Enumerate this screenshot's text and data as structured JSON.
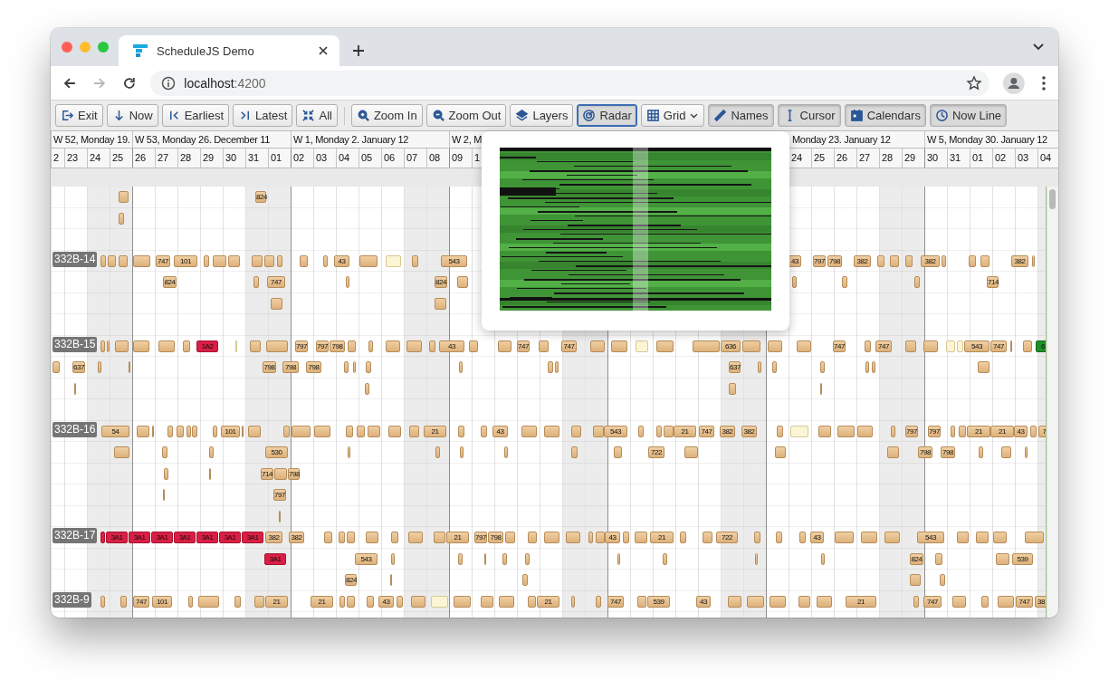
{
  "browser": {
    "tab": {
      "title": "ScheduleJS Demo"
    },
    "nav": [
      {
        "kind": "back",
        "disabled": false
      },
      {
        "kind": "forward",
        "disabled": true
      },
      {
        "kind": "reload",
        "disabled": false
      }
    ],
    "url": {
      "host": "localhost",
      "port": ":4200"
    }
  },
  "toolbar": {
    "groups": [
      [
        {
          "label": "Exit",
          "pressed": false,
          "focused": false,
          "dropdown": false
        },
        {
          "label": "Now",
          "pressed": false,
          "focused": false,
          "dropdown": false
        },
        {
          "label": "Earliest",
          "pressed": false,
          "focused": false,
          "dropdown": false
        },
        {
          "label": "Latest",
          "pressed": false,
          "focused": false,
          "dropdown": false
        },
        {
          "label": "All",
          "pressed": false,
          "focused": false,
          "dropdown": false
        }
      ],
      [
        {
          "label": "Zoom In",
          "pressed": false,
          "focused": false,
          "dropdown": false
        },
        {
          "label": "Zoom Out",
          "pressed": false,
          "focused": false,
          "dropdown": false
        },
        {
          "label": "Layers",
          "pressed": false,
          "focused": false,
          "dropdown": false
        },
        {
          "label": "Radar",
          "pressed": true,
          "focused": true,
          "dropdown": false
        },
        {
          "label": "Grid",
          "pressed": false,
          "focused": false,
          "dropdown": true
        },
        {
          "label": "Names",
          "pressed": true,
          "focused": false,
          "dropdown": false
        },
        {
          "label": "Cursor",
          "pressed": true,
          "focused": false,
          "dropdown": false
        },
        {
          "label": "Calendars",
          "pressed": true,
          "focused": false,
          "dropdown": false
        },
        {
          "label": "Now Line",
          "pressed": true,
          "focused": false,
          "dropdown": false
        }
      ]
    ]
  },
  "timeline": {
    "weeks": [
      {
        "label": "W 52, Monday 19."
      },
      {
        "label": "W 53, Monday 26. December 11"
      },
      {
        "label": "W 1, Monday 2. January 12"
      },
      {
        "label": "W 2, M"
      },
      {
        "label": "Monday 23. January 12"
      },
      {
        "label": "W 5, Monday 30. January 12"
      }
    ],
    "days": [
      {
        "label": "2"
      },
      {
        "label": "23"
      },
      {
        "label": "24"
      },
      {
        "label": "25"
      },
      {
        "label": "26"
      },
      {
        "label": "27"
      },
      {
        "label": "28"
      },
      {
        "label": "29"
      },
      {
        "label": "30"
      },
      {
        "label": "31"
      },
      {
        "label": "01"
      },
      {
        "label": "02"
      },
      {
        "label": "03"
      },
      {
        "label": "04"
      },
      {
        "label": "05"
      },
      {
        "label": "06"
      },
      {
        "label": "07"
      },
      {
        "label": "08"
      },
      {
        "label": "09"
      },
      {
        "label": "1"
      },
      {
        "label": "24"
      },
      {
        "label": "25"
      },
      {
        "label": "26"
      },
      {
        "label": "27"
      },
      {
        "label": "28"
      },
      {
        "label": "29"
      },
      {
        "label": "30"
      },
      {
        "label": "31"
      },
      {
        "label": "01"
      },
      {
        "label": "02"
      },
      {
        "label": "03"
      },
      {
        "label": "04"
      }
    ]
  },
  "radar": {
    "visible": true
  },
  "lanes": [
    {
      "rows": [
        {
          "bars": [
            {
              "kind": "normal"
            },
            {
              "kind": "normal",
              "label": "824"
            }
          ]
        },
        {
          "bars": [
            {
              "kind": "normal"
            }
          ]
        },
        {}
      ]
    },
    {
      "name": "332B-14",
      "rows": [
        {
          "bars": [
            {
              "kind": "normal"
            },
            {
              "kind": "normal"
            },
            {
              "kind": "normal"
            },
            {
              "kind": "normal"
            },
            {
              "kind": "normal",
              "label": "747"
            },
            {
              "kind": "normal",
              "label": "101"
            },
            {
              "kind": "normal"
            },
            {
              "kind": "normal"
            },
            {
              "kind": "normal"
            },
            {
              "kind": "normal"
            },
            {
              "kind": "normal"
            },
            {
              "kind": "normal"
            },
            {
              "kind": "normal"
            },
            {
              "kind": "normal"
            },
            {
              "kind": "normal",
              "label": "43"
            },
            {
              "kind": "normal"
            },
            {
              "kind": "tentative"
            },
            {
              "kind": "normal"
            },
            {
              "kind": "normal",
              "label": "543"
            },
            {
              "kind": "normal",
              "label": "43"
            },
            {
              "kind": "normal",
              "label": "797"
            },
            {
              "kind": "normal",
              "label": "798"
            },
            {
              "kind": "normal",
              "label": "382"
            },
            {
              "kind": "normal"
            },
            {
              "kind": "normal"
            },
            {
              "kind": "normal"
            },
            {
              "kind": "normal",
              "label": "382"
            },
            {
              "kind": "normal"
            },
            {
              "kind": "normal"
            },
            {
              "kind": "normal"
            },
            {
              "kind": "normal",
              "label": "382"
            },
            {
              "kind": "normal"
            }
          ]
        },
        {
          "bars": [
            {
              "kind": "normal",
              "label": "824"
            },
            {
              "kind": "normal"
            },
            {
              "kind": "normal",
              "label": "747"
            },
            {
              "kind": "normal"
            },
            {
              "kind": "normal",
              "label": "824"
            },
            {
              "kind": "normal"
            },
            {
              "kind": "normal"
            },
            {
              "kind": "normal"
            },
            {
              "kind": "normal"
            },
            {
              "kind": "normal",
              "label": "714"
            }
          ]
        },
        {
          "bars": [
            {
              "kind": "normal"
            },
            {
              "kind": "normal"
            }
          ]
        },
        {}
      ]
    },
    {
      "name": "332B-15",
      "rows": [
        {
          "bars": [
            {
              "kind": "normal"
            },
            {
              "kind": "normal"
            },
            {
              "kind": "normal"
            },
            {
              "kind": "normal"
            },
            {
              "kind": "normal"
            },
            {
              "kind": "normal"
            },
            {
              "kind": "critical",
              "label": "1A2"
            },
            {
              "kind": "tentative"
            },
            {
              "kind": "normal"
            },
            {
              "kind": "normal"
            },
            {
              "kind": "normal",
              "label": "797"
            },
            {
              "kind": "normal",
              "label": "797"
            },
            {
              "kind": "normal",
              "label": "798"
            },
            {
              "kind": "normal"
            },
            {
              "kind": "normal"
            },
            {
              "kind": "normal"
            },
            {
              "kind": "normal"
            },
            {
              "kind": "normal"
            },
            {
              "kind": "normal",
              "label": "43"
            },
            {
              "kind": "normal"
            },
            {
              "kind": "normal"
            },
            {
              "kind": "normal",
              "label": "747"
            },
            {
              "kind": "normal"
            },
            {
              "kind": "normal",
              "label": "747"
            },
            {
              "kind": "normal"
            },
            {
              "kind": "normal"
            },
            {
              "kind": "tentative"
            },
            {
              "kind": "normal"
            },
            {
              "kind": "normal"
            },
            {
              "kind": "normal",
              "label": "636"
            },
            {
              "kind": "normal"
            },
            {
              "kind": "normal"
            },
            {
              "kind": "normal"
            },
            {
              "kind": "normal",
              "label": "747"
            },
            {
              "kind": "normal"
            },
            {
              "kind": "normal",
              "label": "747"
            },
            {
              "kind": "normal"
            },
            {
              "kind": "normal"
            },
            {
              "kind": "tentative"
            },
            {
              "kind": "tentative"
            },
            {
              "kind": "normal",
              "label": "543"
            },
            {
              "kind": "normal",
              "label": "747"
            },
            {
              "kind": "normal"
            },
            {
              "kind": "normal"
            },
            {
              "kind": "done",
              "label": "6"
            }
          ]
        },
        {
          "bars": [
            {
              "kind": "normal"
            },
            {
              "kind": "normal",
              "label": "637"
            },
            {
              "kind": "normal"
            },
            {
              "kind": "normal"
            },
            {
              "kind": "normal",
              "label": "798"
            },
            {
              "kind": "normal",
              "label": "798"
            },
            {
              "kind": "normal",
              "label": "798"
            },
            {
              "kind": "normal"
            },
            {
              "kind": "normal"
            },
            {
              "kind": "normal"
            },
            {
              "kind": "normal"
            },
            {
              "kind": "normal"
            },
            {
              "kind": "normal"
            },
            {
              "kind": "normal",
              "label": "637"
            },
            {
              "kind": "normal"
            },
            {
              "kind": "normal"
            },
            {
              "kind": "normal"
            },
            {
              "kind": "normal"
            },
            {
              "kind": "normal"
            },
            {
              "kind": "normal"
            }
          ]
        },
        {
          "bars": [
            {
              "kind": "normal"
            },
            {
              "kind": "normal"
            },
            {
              "kind": "normal"
            },
            {
              "kind": "normal"
            }
          ]
        },
        {}
      ]
    },
    {
      "name": "332B-16",
      "rows": [
        {
          "bars": [
            {
              "kind": "normal",
              "label": "54"
            },
            {
              "kind": "normal"
            },
            {
              "kind": "normal"
            },
            {
              "kind": "normal"
            },
            {
              "kind": "normal"
            },
            {
              "kind": "normal"
            },
            {
              "kind": "normal"
            },
            {
              "kind": "normal"
            },
            {
              "kind": "normal",
              "label": "101"
            },
            {
              "kind": "normal"
            },
            {
              "kind": "normal"
            },
            {
              "kind": "normal"
            },
            {
              "kind": "normal"
            },
            {
              "kind": "normal"
            },
            {
              "kind": "normal"
            },
            {
              "kind": "normal"
            },
            {
              "kind": "normal"
            },
            {
              "kind": "normal"
            },
            {
              "kind": "normal"
            },
            {
              "kind": "normal",
              "label": "21"
            },
            {
              "kind": "normal"
            },
            {
              "kind": "normal"
            },
            {
              "kind": "normal",
              "label": "43"
            },
            {
              "kind": "normal"
            },
            {
              "kind": "normal"
            },
            {
              "kind": "normal"
            },
            {
              "kind": "normal"
            },
            {
              "kind": "normal",
              "label": "543"
            },
            {
              "kind": "normal"
            },
            {
              "kind": "normal"
            },
            {
              "kind": "normal"
            },
            {
              "kind": "normal",
              "label": "21"
            },
            {
              "kind": "normal",
              "label": "747"
            },
            {
              "kind": "normal",
              "label": "382"
            },
            {
              "kind": "normal",
              "label": "382"
            },
            {
              "kind": "normal"
            },
            {
              "kind": "tentative"
            },
            {
              "kind": "normal"
            },
            {
              "kind": "normal"
            },
            {
              "kind": "normal"
            },
            {
              "kind": "normal"
            },
            {
              "kind": "normal",
              "label": "797"
            },
            {
              "kind": "normal",
              "label": "797"
            },
            {
              "kind": "normal"
            },
            {
              "kind": "normal"
            },
            {
              "kind": "normal",
              "label": "21"
            },
            {
              "kind": "normal",
              "label": "21"
            },
            {
              "kind": "normal",
              "label": "43"
            },
            {
              "kind": "normal"
            },
            {
              "kind": "normal",
              "label": "7"
            }
          ]
        },
        {
          "bars": [
            {
              "kind": "normal"
            },
            {
              "kind": "normal"
            },
            {
              "kind": "normal"
            },
            {
              "kind": "normal",
              "label": "530"
            },
            {
              "kind": "normal"
            },
            {
              "kind": "normal"
            },
            {
              "kind": "normal"
            },
            {
              "kind": "normal"
            },
            {
              "kind": "normal"
            },
            {
              "kind": "normal"
            },
            {
              "kind": "normal",
              "label": "722"
            },
            {
              "kind": "normal"
            },
            {
              "kind": "normal"
            },
            {
              "kind": "normal"
            },
            {
              "kind": "normal",
              "label": "798"
            },
            {
              "kind": "normal",
              "label": "798"
            },
            {
              "kind": "normal"
            },
            {
              "kind": "normal"
            },
            {
              "kind": "normal"
            }
          ]
        },
        {
          "bars": [
            {
              "kind": "normal"
            },
            {
              "kind": "normal"
            },
            {
              "kind": "normal",
              "label": "714"
            },
            {
              "kind": "normal"
            },
            {
              "kind": "normal",
              "label": "798"
            }
          ]
        },
        {
          "bars": [
            {
              "kind": "normal"
            },
            {
              "kind": "normal",
              "label": "797"
            }
          ]
        },
        {
          "bars": [
            {
              "kind": "normal"
            }
          ]
        }
      ]
    },
    {
      "name": "332B-17",
      "rows": [
        {
          "bars": [
            {
              "kind": "critical"
            },
            {
              "kind": "critical",
              "label": "3A1"
            },
            {
              "kind": "critical",
              "label": "3A1"
            },
            {
              "kind": "critical",
              "label": "3A1"
            },
            {
              "kind": "critical",
              "label": "3A1"
            },
            {
              "kind": "critical",
              "label": "3A1"
            },
            {
              "kind": "critical",
              "label": "3A1"
            },
            {
              "kind": "critical",
              "label": "3A1"
            },
            {
              "kind": "normal",
              "label": "382"
            },
            {
              "kind": "normal",
              "label": "382"
            },
            {
              "kind": "normal"
            },
            {
              "kind": "normal"
            },
            {
              "kind": "normal"
            },
            {
              "kind": "normal"
            },
            {
              "kind": "normal"
            },
            {
              "kind": "normal"
            },
            {
              "kind": "normal"
            },
            {
              "kind": "normal",
              "label": "21"
            },
            {
              "kind": "normal",
              "label": "797"
            },
            {
              "kind": "normal",
              "label": "798"
            },
            {
              "kind": "normal"
            },
            {
              "kind": "normal"
            },
            {
              "kind": "normal"
            },
            {
              "kind": "normal"
            },
            {
              "kind": "normal"
            },
            {
              "kind": "normal"
            },
            {
              "kind": "normal",
              "label": "43"
            },
            {
              "kind": "normal"
            },
            {
              "kind": "normal"
            },
            {
              "kind": "normal",
              "label": "21"
            },
            {
              "kind": "normal"
            },
            {
              "kind": "normal"
            },
            {
              "kind": "normal",
              "label": "722"
            },
            {
              "kind": "normal"
            },
            {
              "kind": "normal"
            },
            {
              "kind": "normal"
            },
            {
              "kind": "normal",
              "label": "43"
            },
            {
              "kind": "normal"
            },
            {
              "kind": "normal"
            },
            {
              "kind": "normal"
            },
            {
              "kind": "normal",
              "label": "543"
            },
            {
              "kind": "normal"
            },
            {
              "kind": "normal"
            },
            {
              "kind": "normal"
            },
            {
              "kind": "normal"
            }
          ]
        },
        {
          "bars": [
            {
              "kind": "critical",
              "label": "3A1"
            },
            {
              "kind": "normal",
              "label": "543"
            },
            {
              "kind": "normal"
            },
            {
              "kind": "normal"
            },
            {
              "kind": "normal"
            },
            {
              "kind": "normal"
            },
            {
              "kind": "normal"
            },
            {
              "kind": "normal"
            },
            {
              "kind": "normal"
            },
            {
              "kind": "normal"
            },
            {
              "kind": "normal"
            },
            {
              "kind": "normal",
              "label": "824"
            },
            {
              "kind": "normal"
            },
            {
              "kind": "normal"
            },
            {
              "kind": "normal",
              "label": "539"
            }
          ]
        },
        {
          "bars": [
            {
              "kind": "normal",
              "label": "824"
            },
            {
              "kind": "normal"
            },
            {
              "kind": "normal"
            },
            {
              "kind": "normal"
            },
            {
              "kind": "normal"
            }
          ]
        }
      ]
    },
    {
      "name": "332B-9",
      "rows": [
        {
          "bars": [
            {
              "kind": "normal"
            },
            {
              "kind": "normal"
            },
            {
              "kind": "normal",
              "label": "747"
            },
            {
              "kind": "normal",
              "label": "101"
            },
            {
              "kind": "normal"
            },
            {
              "kind": "normal"
            },
            {
              "kind": "normal"
            },
            {
              "kind": "normal"
            },
            {
              "kind": "normal",
              "label": "21"
            },
            {
              "kind": "normal",
              "label": "21"
            },
            {
              "kind": "normal"
            },
            {
              "kind": "normal"
            },
            {
              "kind": "normal"
            },
            {
              "kind": "normal",
              "label": "43"
            },
            {
              "kind": "normal"
            },
            {
              "kind": "normal"
            },
            {
              "kind": "tentative"
            },
            {
              "kind": "normal"
            },
            {
              "kind": "normal"
            },
            {
              "kind": "normal"
            },
            {
              "kind": "normal"
            },
            {
              "kind": "normal",
              "label": "21"
            },
            {
              "kind": "normal"
            },
            {
              "kind": "normal"
            },
            {
              "kind": "normal",
              "label": "747"
            },
            {
              "kind": "normal"
            },
            {
              "kind": "normal",
              "label": "539"
            },
            {
              "kind": "normal",
              "label": "43"
            },
            {
              "kind": "normal"
            },
            {
              "kind": "normal"
            },
            {
              "kind": "normal"
            },
            {
              "kind": "normal"
            },
            {
              "kind": "normal"
            },
            {
              "kind": "normal",
              "label": "21"
            },
            {
              "kind": "normal"
            },
            {
              "kind": "normal",
              "label": "747"
            },
            {
              "kind": "normal"
            },
            {
              "kind": "normal"
            },
            {
              "kind": "normal"
            },
            {
              "kind": "normal",
              "label": "747"
            },
            {
              "kind": "normal",
              "label": "38"
            }
          ]
        }
      ]
    }
  ]
}
